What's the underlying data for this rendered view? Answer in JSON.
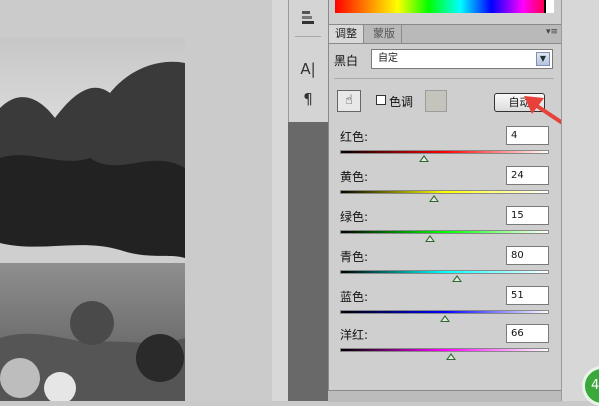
{
  "tabs": {
    "active": "调整",
    "inactive": "蒙版"
  },
  "preset": {
    "label": "黑白",
    "value": "自定"
  },
  "tint": {
    "label": "色调"
  },
  "auto_button": "自动",
  "tools": {
    "char_tool": "A|",
    "para_tool": "¶"
  },
  "sliders": [
    {
      "label": "红色:",
      "value": "4",
      "level": 0.4,
      "gradient": [
        "#000000",
        "#ff0000",
        "#ffffff"
      ]
    },
    {
      "label": "黄色:",
      "value": "24",
      "level": 0.45,
      "gradient": [
        "#000000",
        "#ffff00",
        "#ffffff"
      ]
    },
    {
      "label": "绿色:",
      "value": "15",
      "level": 0.43,
      "gradient": [
        "#000000",
        "#00ff00",
        "#ffffff"
      ]
    },
    {
      "label": "青色:",
      "value": "80",
      "level": 0.56,
      "gradient": [
        "#000000",
        "#00ffff",
        "#ffffff"
      ]
    },
    {
      "label": "蓝色:",
      "value": "51",
      "level": 0.5,
      "gradient": [
        "#000000",
        "#0000ff",
        "#ffffff"
      ]
    },
    {
      "label": "洋红:",
      "value": "66",
      "level": 0.53,
      "gradient": [
        "#000000",
        "#ff00ff",
        "#ffffff"
      ]
    }
  ],
  "colors": {
    "annotation_arrow": "#e8403a",
    "thumb": "#2d6a2d"
  }
}
